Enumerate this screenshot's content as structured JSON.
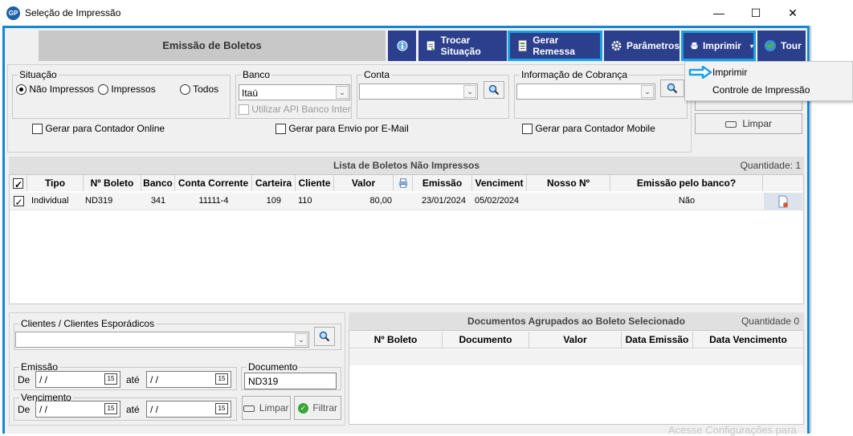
{
  "window": {
    "title": "Seleção de Impressão",
    "icon": "GP",
    "controls": [
      "minimize-icon",
      "maximize-icon",
      "close-icon"
    ]
  },
  "header": {
    "title": "Emissão de Boletos",
    "buttons": {
      "info": "",
      "trocar": "Trocar Situação",
      "remessa": "Gerar Remessa",
      "parametros": "Parâmetros",
      "imprimir": "Imprimir",
      "tour": "Tour"
    }
  },
  "menu": {
    "items": [
      "Imprimir",
      "Controle de Impressão"
    ]
  },
  "filters": {
    "situacao_label": "Situação",
    "radios": [
      "Não Impressos",
      "Impressos",
      "Todos"
    ],
    "selected_radio": "Não Impressos",
    "banco_label": "Banco",
    "banco_value": "Itaú",
    "api_label": "Utilizar API Banco Inter",
    "conta_label": "Conta",
    "conta_value": "",
    "cobranca_label": "Informação de Cobrança",
    "cobranca_value": "",
    "chk_contador_online": "Gerar para Contador Online",
    "chk_email": "Gerar para Envio por E-Mail",
    "chk_contador_mobile": "Gerar para Contador Mobile",
    "limpar_label": "Limpar"
  },
  "boletos": {
    "title": "Lista de Boletos Não Impressos",
    "quantidade": "Quantidade: 1",
    "columns": [
      "Tipo",
      "Nº Boleto",
      "Banco",
      "Conta Corrente",
      "Carteira",
      "Cliente",
      "Valor",
      "",
      "Emissão",
      "Venciment",
      "Nosso Nº",
      "Emissão pelo banco?"
    ],
    "rows": [
      {
        "checked": true,
        "tipo": "Individual",
        "boleto": "ND319",
        "banco": "341",
        "conta": "11111-4",
        "carteira": "109",
        "cliente": "110",
        "valor": "80,00",
        "emissao": "23/01/2024",
        "vencimento": "05/02/2024",
        "nosso": "",
        "emissao_banco": "Não"
      }
    ]
  },
  "bottom_filters": {
    "clientes_label": "Clientes / Clientes Esporádicos",
    "clientes_value": "",
    "emissao_label": "Emissão",
    "vencimento_label": "Vencimento",
    "de_label": "De",
    "ate_label": "até",
    "date_placeholder": " / /",
    "documento_label": "Documento",
    "documento_value": "ND319",
    "limpar_label": "Limpar",
    "filtrar_label": "Filtrar"
  },
  "docs": {
    "title": "Documentos Agrupados ao Boleto Selecionado",
    "quantidade": "Quantidade 0",
    "columns": [
      "Nº Boleto",
      "Documento",
      "Valor",
      "Data Emissão",
      "Data Vencimento"
    ]
  },
  "background_text": "Acesse Configurações para",
  "colors": {
    "header_button": "#2c3f8c",
    "highlight": "#19a0e8",
    "window_border": "#1585d6"
  }
}
